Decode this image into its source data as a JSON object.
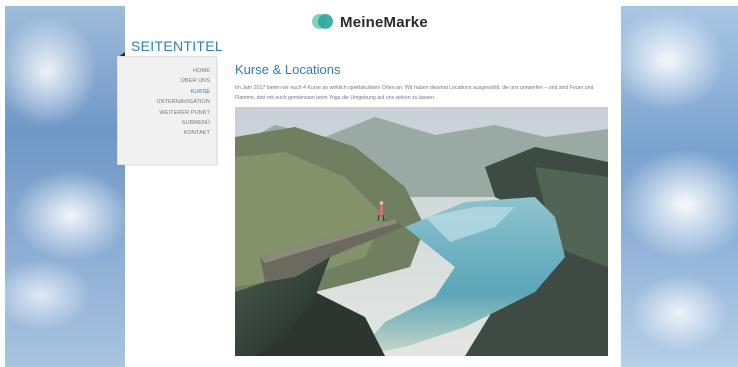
{
  "brand": {
    "name": "MeineMarke",
    "colors": {
      "logo_light": "#7fd1b8",
      "logo_dark": "#2aa7a0"
    }
  },
  "page_title": "SEITENTITEL",
  "nav": {
    "items": [
      {
        "label": "HOME",
        "active": false
      },
      {
        "label": "ÜBER UNS",
        "active": false
      },
      {
        "label": "KURSE",
        "active": true
      },
      {
        "label": "UNTERNAVIGATION",
        "active": false
      },
      {
        "label": "WEITERER PUNKT",
        "active": false
      },
      {
        "label": "SUBMENÜ",
        "active": false
      },
      {
        "label": "KONTAKT",
        "active": false
      }
    ]
  },
  "content": {
    "title": "Kurse & Locations",
    "text_line_1": "Im Jahr 2017 bieten wir euch 4 Kurse an wirklich spektakulären Orten an. Wir haben diesmal Locations ausgewählt, die uns umwerfen – und sind Feuer und",
    "text_line_2": "Flamme, dort mit euch gemeinsam beim Yoga die Umgebung auf uns wirken zu lassen."
  },
  "colors": {
    "accent": "#2f7fb3",
    "nav_bg": "#f1f1f1",
    "text": "#777777"
  }
}
